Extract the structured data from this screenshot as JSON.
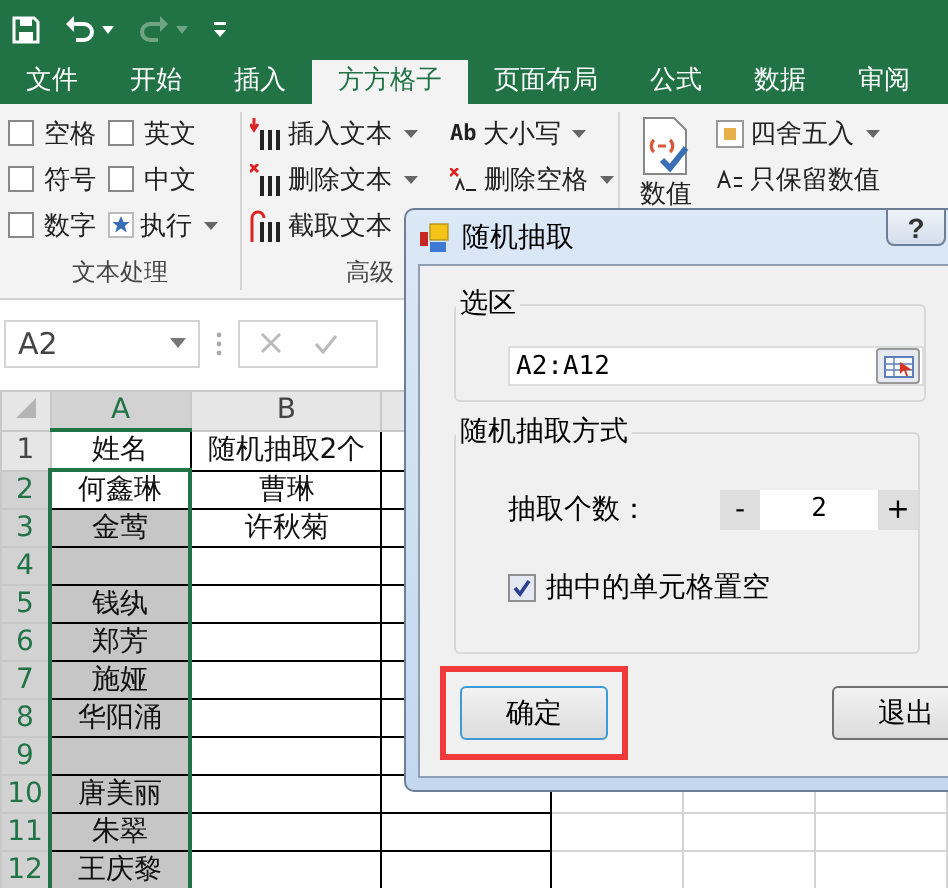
{
  "quick_access": {
    "redo_disabled": true
  },
  "tabs": [
    {
      "label": "文件",
      "selected": false
    },
    {
      "label": "开始",
      "selected": false
    },
    {
      "label": "插入",
      "selected": false
    },
    {
      "label": "方方格子",
      "selected": true
    },
    {
      "label": "页面布局",
      "selected": false
    },
    {
      "label": "公式",
      "selected": false
    },
    {
      "label": "数据",
      "selected": false
    },
    {
      "label": "审阅",
      "selected": false
    }
  ],
  "ribbon": {
    "text_group": {
      "label": "文本处理",
      "options": [
        {
          "label": "空格",
          "checked": false
        },
        {
          "label": "英文",
          "checked": false
        },
        {
          "label": "符号",
          "checked": false
        },
        {
          "label": "中文",
          "checked": false
        },
        {
          "label": "数字",
          "checked": false
        }
      ],
      "run": "执行"
    },
    "advanced_group": {
      "label": "高级",
      "commands": [
        {
          "label": "插入文本",
          "kind": "insert"
        },
        {
          "label": "删除文本",
          "kind": "delete"
        },
        {
          "label": "截取文本",
          "kind": "extract"
        }
      ],
      "case": "大小写",
      "case_icon": "Ab",
      "trim": "删除空格"
    },
    "number_group": {
      "big": "数值",
      "round": "四舍五入",
      "keep": "只保留数值"
    }
  },
  "formula_bar": {
    "name_box": "A2"
  },
  "sheet": {
    "columns": [
      {
        "label": "A",
        "selected": true
      },
      {
        "label": "B",
        "selected": false
      }
    ],
    "rows": [
      {
        "number": "1",
        "selected": false,
        "active": false,
        "cells": [
          "姓名",
          "随机抽取2个"
        ]
      },
      {
        "number": "2",
        "selected": true,
        "active": true,
        "cells": [
          "何鑫琳",
          "曹琳"
        ]
      },
      {
        "number": "3",
        "selected": true,
        "active": false,
        "cells": [
          "金莺",
          "许秋菊"
        ]
      },
      {
        "number": "4",
        "selected": true,
        "active": false,
        "cells": [
          "",
          ""
        ]
      },
      {
        "number": "5",
        "selected": true,
        "active": false,
        "cells": [
          "钱纨",
          ""
        ]
      },
      {
        "number": "6",
        "selected": true,
        "active": false,
        "cells": [
          "郑芳",
          ""
        ]
      },
      {
        "number": "7",
        "selected": true,
        "active": false,
        "cells": [
          "施娅",
          ""
        ]
      },
      {
        "number": "8",
        "selected": true,
        "active": false,
        "cells": [
          "华阳涌",
          ""
        ]
      },
      {
        "number": "9",
        "selected": true,
        "active": false,
        "cells": [
          "",
          ""
        ]
      },
      {
        "number": "10",
        "selected": true,
        "active": false,
        "cells": [
          "唐美丽",
          ""
        ]
      },
      {
        "number": "11",
        "selected": true,
        "active": false,
        "cells": [
          "朱翠",
          ""
        ]
      },
      {
        "number": "12",
        "selected": true,
        "active": false,
        "cells": [
          "王庆黎",
          ""
        ]
      }
    ]
  },
  "dialog": {
    "title": "随机抽取",
    "help": "?",
    "range_group": "选区",
    "range": "A2:A12",
    "method_group": "随机抽取方式",
    "count_label": "抽取个数：",
    "minus": "-",
    "count": "2",
    "plus": "+",
    "clear_option": {
      "label": "抽中的单元格置空",
      "checked": true
    },
    "ok": {
      "label": "确定",
      "highlighted": true
    },
    "exit": "退出"
  }
}
